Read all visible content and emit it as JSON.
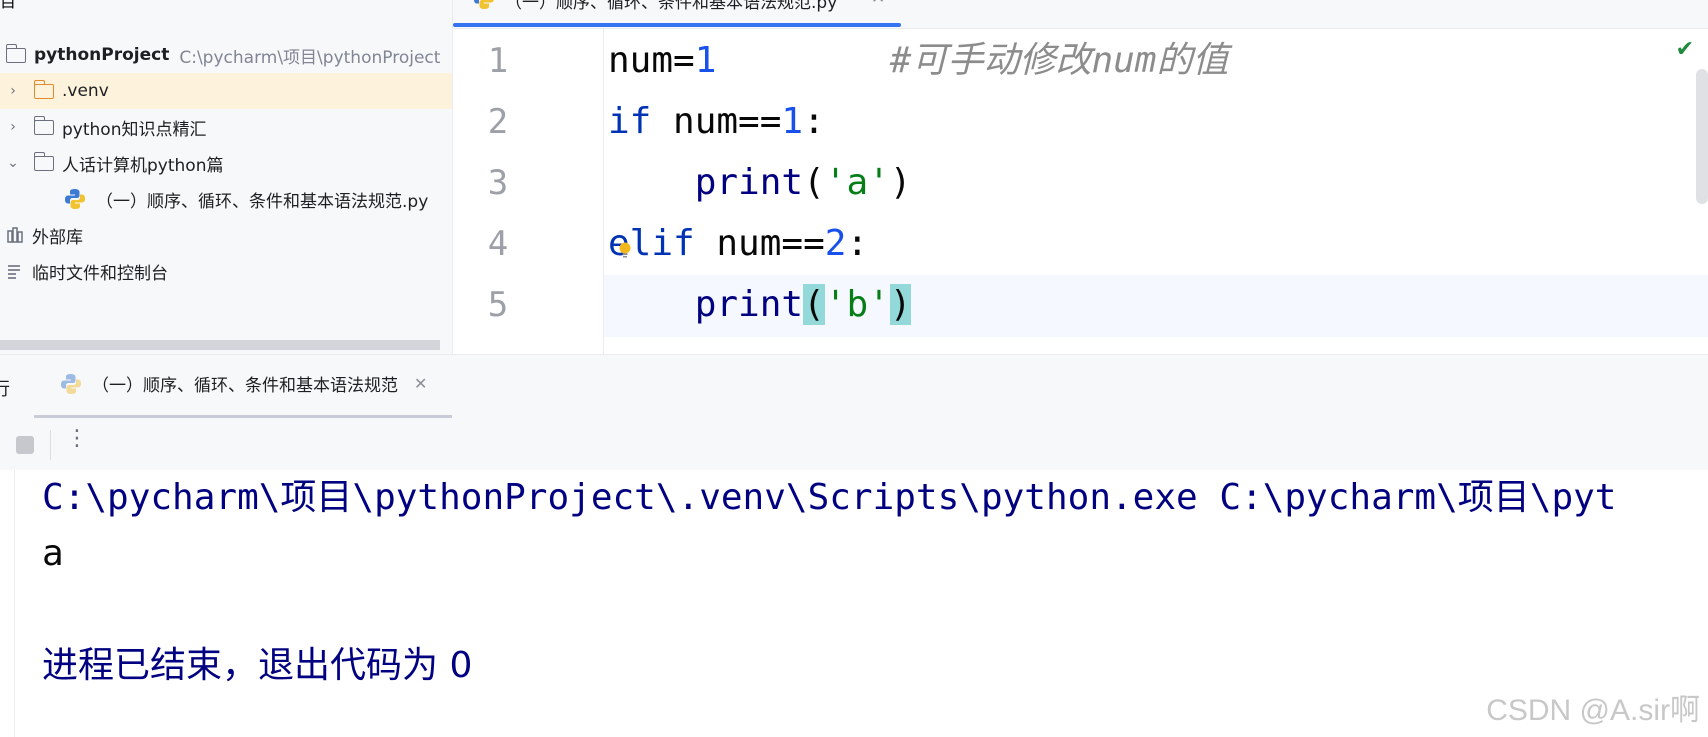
{
  "project_panel": {
    "header_partial": "目",
    "root": {
      "name": "pythonProject",
      "path": "C:\\pycharm\\项目\\pythonProject"
    },
    "items": [
      {
        "label": ".venv",
        "kind": "folder-excluded",
        "expanded": false
      },
      {
        "label": "python知识点精汇",
        "kind": "folder",
        "expanded": false
      },
      {
        "label": "人话计算机python篇",
        "kind": "folder",
        "expanded": true
      },
      {
        "label": "（一）顺序、循环、条件和基本语法规范.py",
        "kind": "python-file"
      },
      {
        "label": "外部库",
        "kind": "library"
      },
      {
        "label": "临时文件和控制台",
        "kind": "scratches"
      }
    ]
  },
  "editor": {
    "tab_label": "（一）顺序、循环、条件和基本语法规范.py",
    "inspection_status": "✔",
    "lines": [
      {
        "number": "1"
      },
      {
        "number": "2"
      },
      {
        "number": "3"
      },
      {
        "number": "4"
      },
      {
        "number": "5"
      }
    ],
    "code": {
      "l1_var": "num=",
      "l1_num": "1",
      "l1_comment": "#可手动修改num的值",
      "l2_kw": "if",
      "l2_expr": " num==",
      "l2_num": "1",
      "l2_colon": ":",
      "l3_fn": "print",
      "l3_open": "(",
      "l3_str": "'a'",
      "l3_close": ")",
      "l4_kw": "elif",
      "l4_expr": " num==",
      "l4_num": "2",
      "l4_colon": ":",
      "l5_fn": "print",
      "l5_open": "(",
      "l5_str": "'b'",
      "l5_close": ")"
    }
  },
  "run_window": {
    "title_partial": "行",
    "tab_label": "（一）顺序、循环、条件和基本语法规范",
    "console": [
      {
        "text": "C:\\pycharm\\项目\\pythonProject\\.venv\\Scripts\\python.exe C:\\pycharm\\项目\\pyt",
        "kind": "system"
      },
      {
        "text": "a",
        "kind": "output"
      },
      {
        "text": "",
        "kind": "blank"
      },
      {
        "text": "进程已结束，退出代码为 0",
        "kind": "system"
      }
    ]
  },
  "watermark": "CSDN @A.sir啊",
  "colors": {
    "keyword": "#0033b3",
    "number": "#1750eb",
    "string": "#067d17",
    "builtin": "#000080",
    "comment": "#8c8c8c",
    "selected_row": "#fdf3dc",
    "tab_accent": "#3574f0"
  }
}
